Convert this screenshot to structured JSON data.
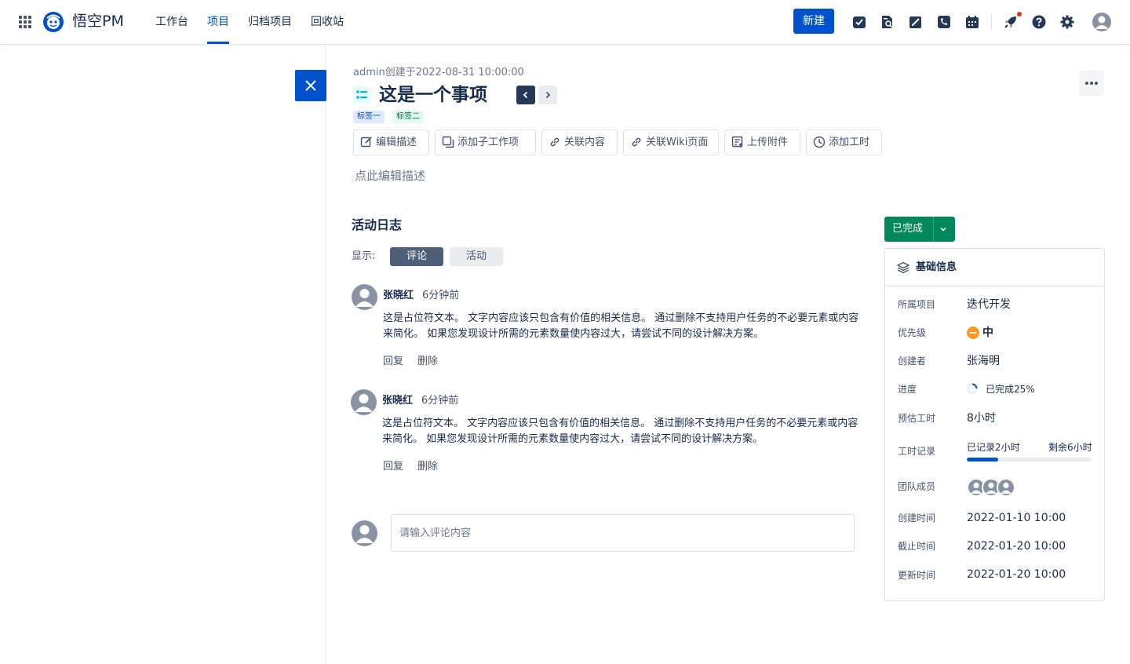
{
  "app": {
    "brand": "悟空PM",
    "nav": [
      "工作台",
      "项目",
      "归档项目",
      "回收站"
    ],
    "active_nav": "项目",
    "new_button": "新建"
  },
  "issue": {
    "meta": "admin创建于2022-08-31  10:00:00",
    "title": "这是一个事项",
    "tags": [
      "标签一",
      "标签二"
    ],
    "actions": [
      "编辑描述",
      "添加子工作项",
      "关联内容",
      "关联Wiki页面",
      "上传附件",
      "添加工时"
    ],
    "description_placeholder": "点此编辑描述"
  },
  "activity": {
    "title": "活动日志",
    "show_label": "显示:",
    "filters": [
      "评论",
      "活动"
    ],
    "active_filter": "评论",
    "comments": [
      {
        "author": "张晓红",
        "time": "6分钟前",
        "body": "这是占位符文本。 文字内容应该只包含有价值的相关信息。 通过删除不支持用户任务的不必要元素或内容来简化。 如果您发现设计所需的元素数量使内容过大，请尝试不同的设计解决方案。",
        "reply": "回复",
        "delete": "删除"
      },
      {
        "author": "张晓红",
        "time": "6分钟前",
        "body": "这是占位符文本。 文字内容应该只包含有价值的相关信息。 通过删除不支持用户任务的不必要元素或内容来简化。 如果您发现设计所需的元素数量使内容过大，请尝试不同的设计解决方案。",
        "reply": "回复",
        "delete": "删除"
      }
    ],
    "input_placeholder": "请输入评论内容"
  },
  "sidebar": {
    "status": "已完成",
    "status_color": "#00875a",
    "card_title": "基础信息",
    "fields": {
      "project": {
        "label": "所属项目",
        "value": "迭代开发"
      },
      "priority": {
        "label": "优先级",
        "value": "中",
        "color": "#ff991f"
      },
      "creator": {
        "label": "创建者",
        "value": "张海明"
      },
      "progress": {
        "label": "进度",
        "value": "已完成25%",
        "percent": 25
      },
      "estimate": {
        "label": "预估工时",
        "value": "8小时"
      },
      "worklog": {
        "label": "工时记录",
        "logged": "已记录2小时",
        "remaining": "剩余6小时",
        "fraction": 0.25
      },
      "team": {
        "label": "团队成员",
        "count": 3
      },
      "created": {
        "label": "创建时间",
        "value": "2022-01-10 10:00"
      },
      "deadline": {
        "label": "截止时间",
        "value": "2022-01-20 10:00"
      },
      "updated": {
        "label": "更新时间",
        "value": "2022-01-20 10:00"
      }
    }
  },
  "colors": {
    "primary": "#0052cc",
    "success": "#00875a",
    "text": "#172b4d",
    "subtle": "#6b778c"
  }
}
